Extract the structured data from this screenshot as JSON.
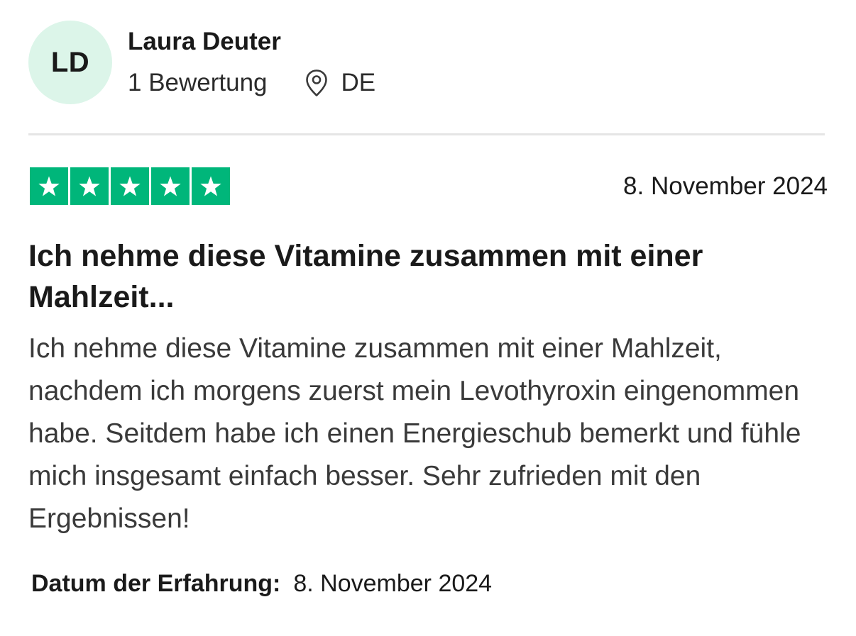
{
  "reviewer": {
    "initials": "LD",
    "name": "Laura Deuter",
    "review_count": "1 Bewertung",
    "country": "DE",
    "avatar_color": "#dcf5e9"
  },
  "review": {
    "rating": 5,
    "max_rating": 5,
    "star_color": "#00b67a",
    "date": "8. November 2024",
    "title": "Ich nehme diese Vitamine zusammen mit einer Mahlzeit...",
    "body": "Ich nehme diese Vitamine zusammen mit einer Mahlzeit, nachdem ich morgens zuerst mein Levothyroxin eingenommen habe. Seitdem habe ich einen Energieschub bemerkt und fühle mich insgesamt einfach besser. Sehr zufrieden mit den Ergebnissen!",
    "experience_label": "Datum der Erfahrung:",
    "experience_date": "8. November 2024"
  },
  "icons": {
    "location": "location-pin-icon",
    "star": "star-icon"
  }
}
